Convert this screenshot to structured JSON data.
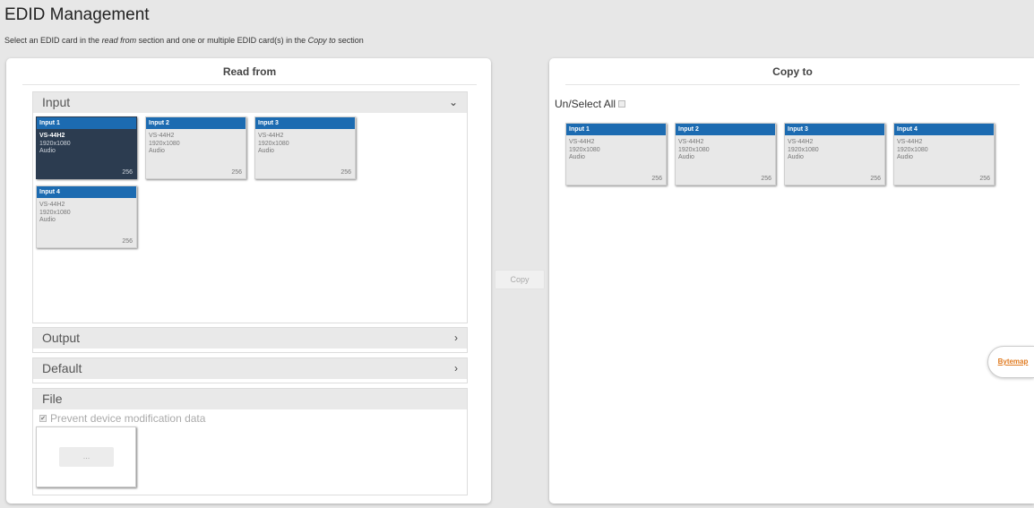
{
  "page": {
    "title": "EDID Management",
    "subtitle_prefix": "Select an EDID card in the ",
    "subtitle_em1": "read from",
    "subtitle_middle": " section and one or multiple EDID card(s) in the ",
    "subtitle_em2": "Copy to",
    "subtitle_suffix": " section"
  },
  "read_from": {
    "title": "Read from",
    "sections": {
      "input": {
        "label": "Input",
        "chevron": "⌄"
      },
      "output": {
        "label": "Output",
        "chevron": "›"
      },
      "default": {
        "label": "Default",
        "chevron": "›"
      },
      "file": {
        "label": "File"
      }
    },
    "input_cards": [
      {
        "header": "Input 1",
        "model": "VS-44H2",
        "resolution": "1920x1080",
        "audio": "Audio",
        "count": "256",
        "selected": true
      },
      {
        "header": "Input 2",
        "model": "VS-44H2",
        "resolution": "1920x1080",
        "audio": "Audio",
        "count": "256",
        "selected": false
      },
      {
        "header": "Input 3",
        "model": "VS-44H2",
        "resolution": "1920x1080",
        "audio": "Audio",
        "count": "256",
        "selected": false
      },
      {
        "header": "Input 4",
        "model": "VS-44H2",
        "resolution": "1920x1080",
        "audio": "Audio",
        "count": "256",
        "selected": false
      }
    ],
    "file": {
      "prevent_label": "Prevent device modification data",
      "prevent_checked": true,
      "browse_label": "..."
    }
  },
  "copy": {
    "label": "Copy"
  },
  "copy_to": {
    "title": "Copy to",
    "select_all_label": "Un/Select All",
    "cards": [
      {
        "header": "Input 1",
        "model": "VS-44H2",
        "resolution": "1920x1080",
        "audio": "Audio",
        "count": "256"
      },
      {
        "header": "Input 2",
        "model": "VS-44H2",
        "resolution": "1920x1080",
        "audio": "Audio",
        "count": "256"
      },
      {
        "header": "Input 3",
        "model": "VS-44H2",
        "resolution": "1920x1080",
        "audio": "Audio",
        "count": "256"
      },
      {
        "header": "Input 4",
        "model": "VS-44H2",
        "resolution": "1920x1080",
        "audio": "Audio",
        "count": "256"
      }
    ]
  },
  "bytemap": {
    "label": "Bytemap"
  },
  "colors": {
    "card_header": "#1c6bb1",
    "selected_card": "#2c3c50",
    "bytemap_link": "#e07a1f"
  }
}
